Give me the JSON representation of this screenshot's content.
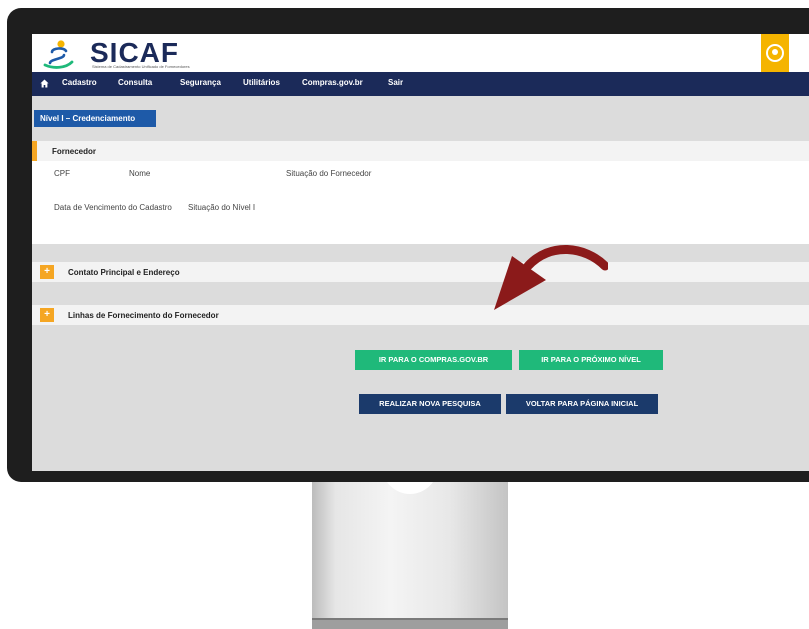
{
  "app": {
    "brand": "SICAF",
    "brand_subtitle": "Sistema de Cadastramento Unificado de Fornecedores"
  },
  "nav": {
    "items": [
      "Cadastro",
      "Consulta",
      "Segurança",
      "Utilitários",
      "Compras.gov.br",
      "Sair"
    ]
  },
  "level_tab": "Nível I – Credenciamento",
  "fornecedor": {
    "title": "Fornecedor",
    "fields": [
      "CPF",
      "Nome",
      "Situação do Fornecedor",
      "Data de Vencimento do Cadastro",
      "Situação do Nível I"
    ]
  },
  "sections": [
    {
      "icon": "+",
      "label": "Contato Principal e Endereço"
    },
    {
      "icon": "+",
      "label": "Linhas de Fornecimento do Fornecedor"
    }
  ],
  "buttons": {
    "compras": "IR PARA O COMPRAS.GOV.BR",
    "proximo": "IR PARA O PRÓXIMO NÍVEL",
    "pesquisa": "REALIZAR NOVA PESQUISA",
    "voltar": "VOLTAR PARA PÁGINA INICIAL"
  },
  "colors": {
    "navy": "#1b2a59",
    "accent": "#f5a623",
    "green": "#1fb97a",
    "button_navy": "#1b3a6b",
    "arrow": "#8b1a1a"
  },
  "icons": [
    "home-icon",
    "user-avatar-icon",
    "plus-icon",
    "curved-arrow-icon"
  ]
}
